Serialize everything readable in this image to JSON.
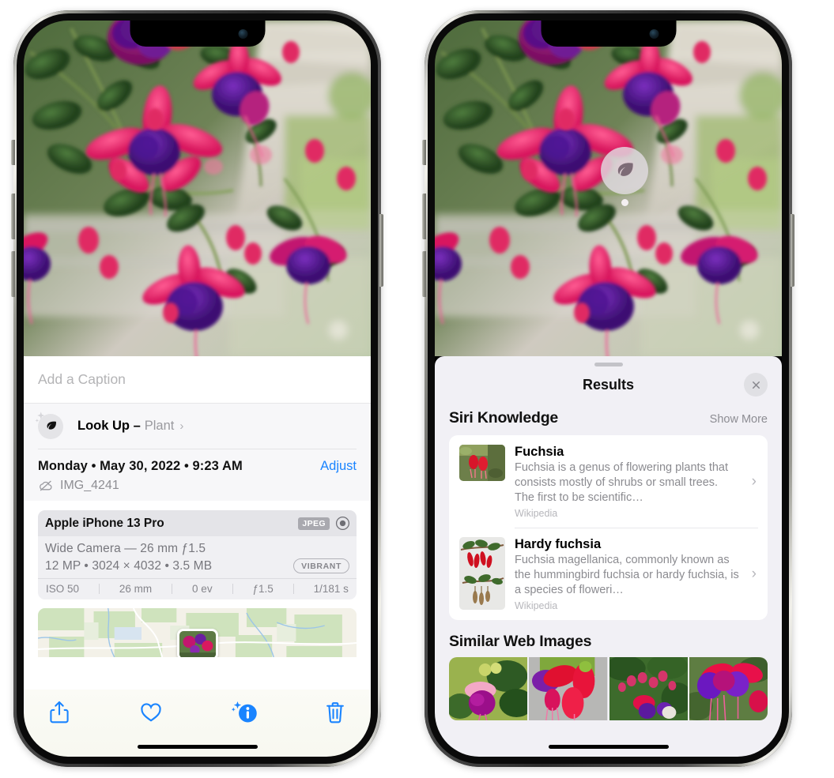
{
  "left_phone": {
    "caption_placeholder": "Add a Caption",
    "lookup": {
      "label": "Look Up –",
      "subject": "Plant",
      "chevron": "›",
      "icon": "leaf-icon"
    },
    "date_text": "Monday • May 30, 2022 • 9:23 AM",
    "adjust_label": "Adjust",
    "file_name": "IMG_4241",
    "camera": {
      "model": "Apple iPhone 13 Pro",
      "format_chip": "JPEG",
      "lens_line": "Wide Camera — 26 mm ƒ1.5",
      "size_line": "12 MP • 3024 × 4032 • 3.5 MB",
      "style_chip": "VIBRANT",
      "exif": [
        "ISO 50",
        "26 mm",
        "0 ev",
        "ƒ1.5",
        "1/181 s"
      ]
    },
    "toolbar": [
      {
        "name": "share-icon",
        "label": "Share"
      },
      {
        "name": "heart-icon",
        "label": "Favorite"
      },
      {
        "name": "info-sparkle-icon",
        "label": "Info"
      },
      {
        "name": "trash-icon",
        "label": "Delete"
      }
    ]
  },
  "right_phone": {
    "pin": {
      "icon": "leaf-icon"
    },
    "results_title": "Results",
    "close_label": "✕",
    "siri_section": {
      "title": "Siri Knowledge",
      "show_more": "Show More",
      "items": [
        {
          "title": "Fuchsia",
          "desc": "Fuchsia is a genus of flowering plants that consists mostly of shrubs or small trees. The first to be scientific…",
          "source": "Wikipedia",
          "chevron": "›"
        },
        {
          "title": "Hardy fuchsia",
          "desc": "Fuchsia magellanica, commonly known as the hummingbird fuchsia or hardy fuchsia, is a species of floweri…",
          "source": "Wikipedia",
          "chevron": "›"
        }
      ]
    },
    "similar_section": {
      "title": "Similar Web Images",
      "count": 4
    }
  },
  "colors": {
    "accent_blue": "#1a84ff",
    "panel_bg": "#f1f0f5",
    "card_bg": "#ffffff",
    "muted_text": "#8b8b90"
  }
}
